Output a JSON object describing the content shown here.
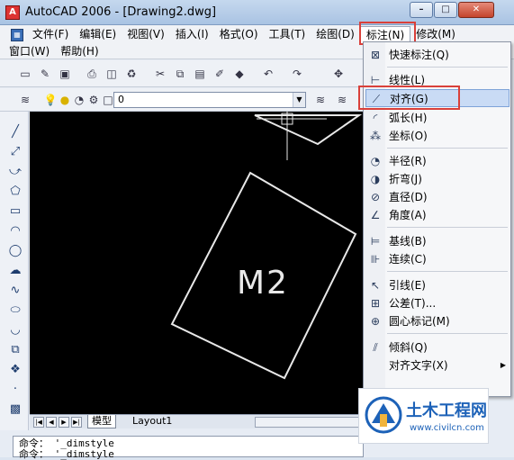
{
  "window": {
    "title": "AutoCAD 2006 - [Drawing2.dwg]",
    "app_icon_letter": "A",
    "min": "–",
    "max": "□",
    "close": "✕"
  },
  "menubar": {
    "row1": [
      "文件(F)",
      "编辑(E)",
      "视图(V)",
      "插入(I)",
      "格式(O)",
      "工具(T)",
      "绘图(D)",
      "标注(N)",
      "修改(M)"
    ],
    "row2": [
      "窗口(W)",
      "帮助(H)"
    ],
    "active": "标注(N)"
  },
  "layer_toolbar": {
    "layer_value": "0"
  },
  "canvas": {
    "shape_label": "M2",
    "background": "#000000"
  },
  "tabs": {
    "model": "模型",
    "layout1": "Layout1"
  },
  "command_line": {
    "line1": "命令： '_dimstyle",
    "line2": "命令： '_dimstyle"
  },
  "dropdown": {
    "items": [
      {
        "label": "快速标注(Q)",
        "icon": "quick-dimension-icon",
        "glyph": "⊠"
      },
      {
        "label": "线性(L)",
        "icon": "linear-dimension-icon",
        "glyph": "⊢"
      },
      {
        "label": "对齐(G)",
        "icon": "aligned-dimension-icon",
        "glyph": "⟋",
        "highlighted": true
      },
      {
        "label": "弧长(H)",
        "icon": "arc-length-icon",
        "glyph": "◜"
      },
      {
        "label": "坐标(O)",
        "icon": "ordinate-icon",
        "glyph": "⁂"
      },
      {
        "label": "半径(R)",
        "icon": "radius-icon",
        "glyph": "◔"
      },
      {
        "label": "折弯(J)",
        "icon": "jogged-icon",
        "glyph": "◑"
      },
      {
        "label": "直径(D)",
        "icon": "diameter-icon",
        "glyph": "⊘"
      },
      {
        "label": "角度(A)",
        "icon": "angular-icon",
        "glyph": "∠"
      },
      {
        "label": "基线(B)",
        "icon": "baseline-icon",
        "glyph": "⊨"
      },
      {
        "label": "连续(C)",
        "icon": "continue-icon",
        "glyph": "⊪"
      },
      {
        "label": "引线(E)",
        "icon": "leader-icon",
        "glyph": "↖"
      },
      {
        "label": "公差(T)...",
        "icon": "tolerance-icon",
        "glyph": "⊞"
      },
      {
        "label": "圆心标记(M)",
        "icon": "center-mark-icon",
        "glyph": "⊕"
      },
      {
        "label": "倾斜(Q)",
        "icon": "oblique-icon",
        "glyph": "⫽"
      },
      {
        "label": "对齐文字(X)",
        "icon": "",
        "glyph": ""
      }
    ]
  },
  "watermark": {
    "title": "土木工程网",
    "url": "www.civilcn.com"
  },
  "colors": {
    "highlight_box": "#d9403a",
    "menu_highlight": "#c9dbf5"
  }
}
